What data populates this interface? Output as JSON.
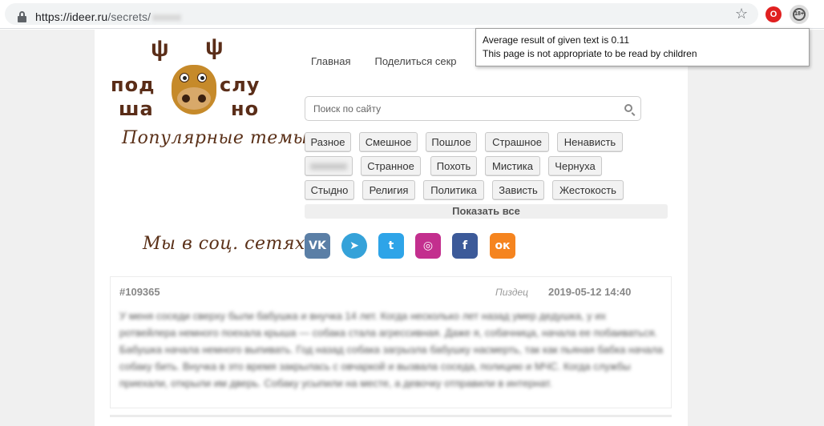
{
  "browser": {
    "url_host": "https://ideer.ru",
    "url_path": "/secrets/",
    "extensions": {
      "adblock_label": "O",
      "age_rating_label": "18+"
    }
  },
  "tooltip": {
    "line1": "Average result of given text is 0.11",
    "line2": "This page is not appropriate to be read by children"
  },
  "logo": {
    "words": [
      "под",
      "слу",
      "ша",
      "но"
    ]
  },
  "nav": {
    "items": [
      "Главная",
      "Поделиться секр"
    ]
  },
  "search": {
    "placeholder": "Поиск по сайту"
  },
  "popular": {
    "title": "Популярные темы:",
    "tags": [
      "Разное",
      "Смешное",
      "Пошлое",
      "Страшное",
      "Ненависть",
      "",
      "Странное",
      "Похоть",
      "Мистика",
      "Чернуха",
      "Стыдно",
      "Религия",
      "Политика",
      "Зависть",
      "Жестокость"
    ],
    "show_all": "Показать все"
  },
  "social": {
    "title": "Мы в соц. сетях:",
    "networks": [
      {
        "name": "vk",
        "label": "VK",
        "color": "#5b7fa6"
      },
      {
        "name": "telegram",
        "label": "➤",
        "color": "#35a2d9"
      },
      {
        "name": "twitter",
        "label": "t",
        "color": "#2ea4e8"
      },
      {
        "name": "instagram",
        "label": "◎",
        "color": "#c32f8e"
      },
      {
        "name": "facebook",
        "label": "f",
        "color": "#3c5a99"
      },
      {
        "name": "odnoklassniki",
        "label": "ок",
        "color": "#f5841f"
      }
    ]
  },
  "post": {
    "id": "#109365",
    "category": "Пиздец",
    "date": "2019-05-12 14:40",
    "text": "У меня соседи сверху были бабушка и внучка 14 лет. Когда несколько лет назад умер дедушка, у их ротвейлера немного поехала крыша — собака стала агрессивная. Даже я, собачница, начала ее побаиваться. Бабушка начала немного выпивать. Год назад собака загрызла бабушку насмерть, так как пьяная бабка начала собаку бить. Внучка в это время закрылась с овчаркой и вызвала соседа, полицию и МЧС. Когда службы приехали, открыли им дверь. Собаку усыпили на месте, а девочку отправили в интернат."
  },
  "colors": {
    "brand_brown": "#5a2d18",
    "page_bg": "#f0f0f0"
  }
}
